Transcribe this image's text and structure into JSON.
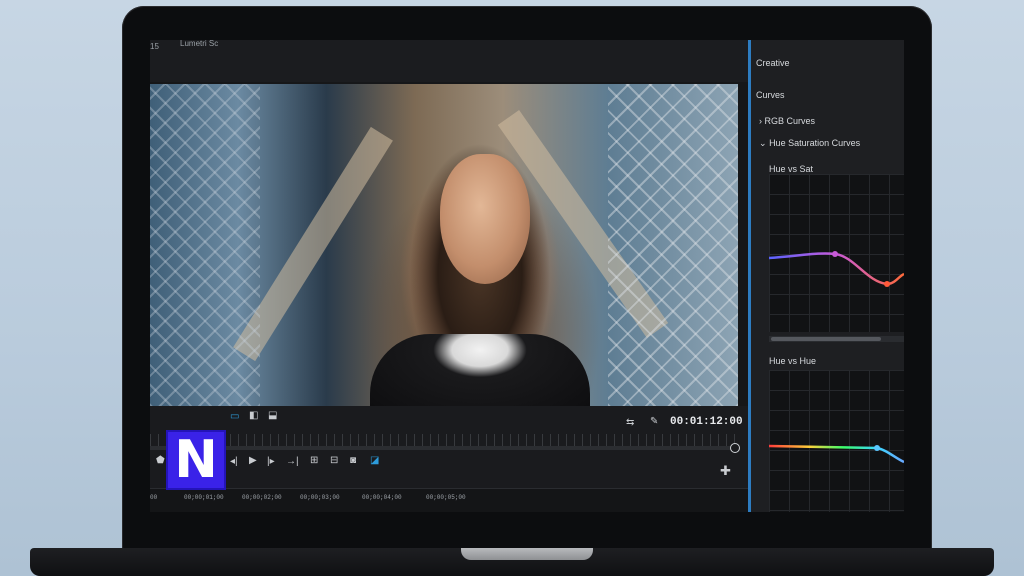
{
  "viewer": {
    "timecode_top": "15",
    "sequence_label": "Lumetri Sc",
    "playhead_timecode": "00:01:12:00"
  },
  "timeline": {
    "timestamps": [
      "00",
      "00;00;01;00",
      "00;00;02;00",
      "00;00;03;00",
      "00;00;04;00",
      "00;00;05;00"
    ]
  },
  "panel": {
    "creative_label": "Creative",
    "curves_label": "Curves",
    "rgb_curves_label": "RGB Curves",
    "hue_sat_curves_label": "Hue Saturation Curves",
    "hue_vs_sat_label": "Hue vs Sat",
    "hue_vs_hue_label": "Hue vs Hue"
  },
  "logo": {
    "letter": "N",
    "color": "#3a22e8"
  },
  "colors": {
    "accent": "#2d7cc1",
    "playhead_blue": "#2d9cdb"
  },
  "icons": [
    "safe-margins-icon",
    "compare-view-icon",
    "toggle-overlay-icon",
    "settings-swap-icon",
    "wrench-icon",
    "marker-icon",
    "step-back-icon",
    "play-icon",
    "step-forward-icon",
    "go-to-out-icon",
    "insert-icon",
    "overwrite-icon",
    "camera-icon",
    "export-frame-icon",
    "add-button-icon"
  ]
}
